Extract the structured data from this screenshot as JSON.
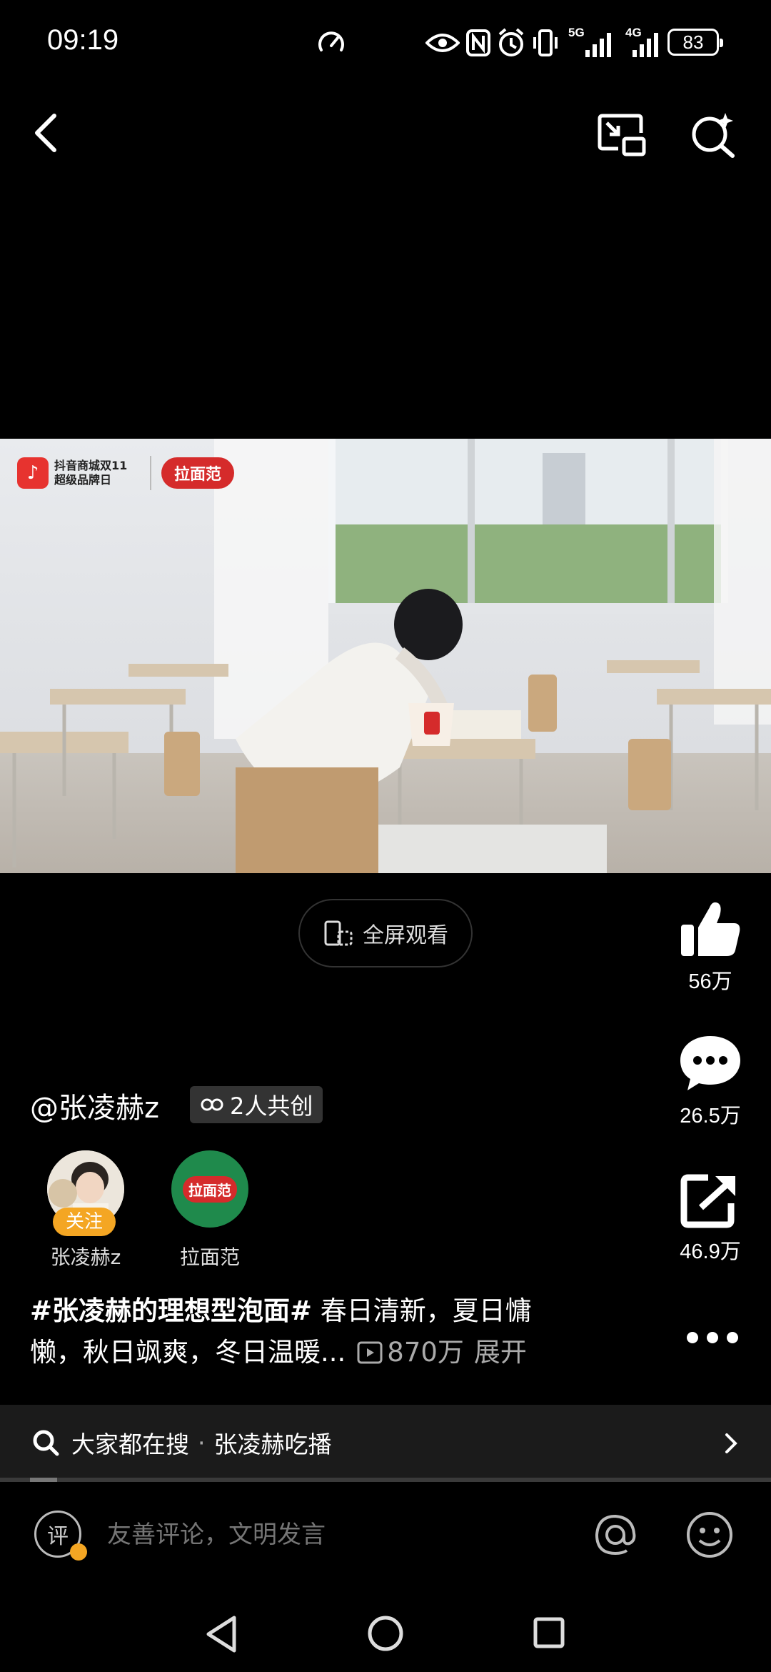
{
  "status_bar": {
    "time": "09:19",
    "network_1": "5G",
    "network_2": "4G",
    "battery": "83"
  },
  "video": {
    "logo_left": "抖音商城双11 超级品牌日",
    "logo_brand": "拉面范"
  },
  "fullscreen_label": "全屏观看",
  "actions": {
    "likes": "56万",
    "comments": "26.5万",
    "shares": "46.9万"
  },
  "author": {
    "handle": "@张凌赫z",
    "cocreate_label": "2人共创"
  },
  "creators": [
    {
      "name": "张凌赫z",
      "follow_label": "关注"
    },
    {
      "name": "拉面范",
      "avatar_text": "拉面范"
    }
  ],
  "description": {
    "hashtag": "#张凌赫的理想型泡面#",
    "text_line1": " 春日清新，夏日慵",
    "text_line2": "懒，秋日飒爽，冬日温暖...",
    "views": "870万",
    "expand": "展开"
  },
  "search": {
    "prefix": "大家都在搜",
    "dot": "·",
    "query": "张凌赫吃播"
  },
  "progress": 0.035,
  "comment": {
    "placeholder": "友善评论，文明发言",
    "badge": "评"
  },
  "colors": {
    "follow": "#f4a623",
    "brand_red": "#d52b2b",
    "brand_green": "#1f8a4c"
  }
}
